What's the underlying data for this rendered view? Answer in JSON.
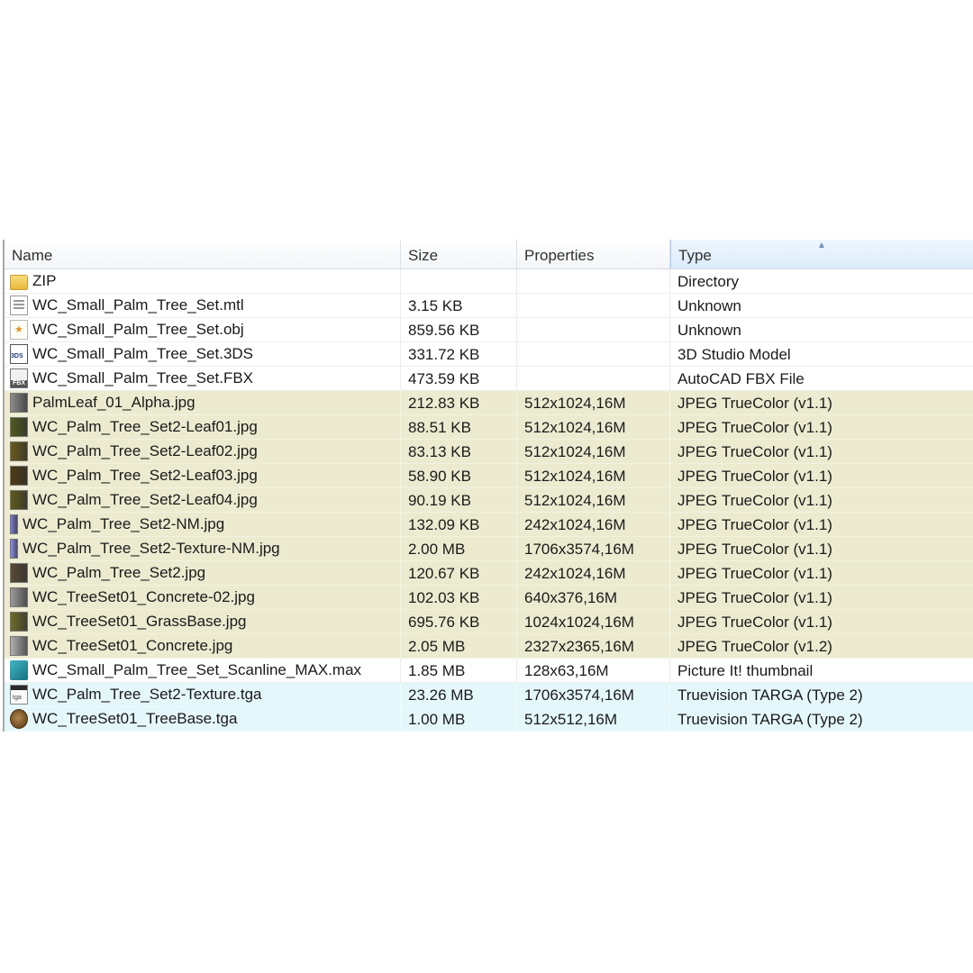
{
  "columns": {
    "name": "Name",
    "size": "Size",
    "properties": "Properties",
    "type": "Type"
  },
  "sort_indicator": "▲",
  "colors": {
    "jpeg_row_highlight": "#ecebd0",
    "tga_row_highlight": "#e4f7fb"
  },
  "rows": [
    {
      "name": "ZIP",
      "size": "",
      "properties": "",
      "type": "Directory",
      "icon": "folder-icon",
      "group": ""
    },
    {
      "name": "WC_Small_Palm_Tree_Set.mtl",
      "size": "3.15 KB",
      "properties": "",
      "type": "Unknown",
      "icon": "document-icon",
      "group": ""
    },
    {
      "name": "WC_Small_Palm_Tree_Set.obj",
      "size": "859.56 KB",
      "properties": "",
      "type": "Unknown",
      "icon": "obj-file-icon",
      "group": ""
    },
    {
      "name": "WC_Small_Palm_Tree_Set.3DS",
      "size": "331.72 KB",
      "properties": "",
      "type": "3D Studio Model",
      "icon": "3ds-file-icon",
      "group": ""
    },
    {
      "name": "WC_Small_Palm_Tree_Set.FBX",
      "size": "473.59 KB",
      "properties": "",
      "type": "AutoCAD FBX File",
      "icon": "fbx-file-icon",
      "group": ""
    },
    {
      "name": "PalmLeaf_01_Alpha.jpg",
      "size": "212.83 KB",
      "properties": "512x1024,16M",
      "type": "JPEG TrueColor (v1.1)",
      "icon": "alpha-thumbnail-icon",
      "group": "jpg",
      "thumb": "#8a8a8a"
    },
    {
      "name": "WC_Palm_Tree_Set2-Leaf01.jpg",
      "size": "88.51 KB",
      "properties": "512x1024,16M",
      "type": "JPEG TrueColor (v1.1)",
      "icon": "leaf-thumbnail-icon",
      "group": "jpg",
      "thumb": "#4f5a1d"
    },
    {
      "name": "WC_Palm_Tree_Set2-Leaf02.jpg",
      "size": "83.13 KB",
      "properties": "512x1024,16M",
      "type": "JPEG TrueColor (v1.1)",
      "icon": "leaf-thumbnail-icon",
      "group": "jpg",
      "thumb": "#6b5a1c"
    },
    {
      "name": "WC_Palm_Tree_Set2-Leaf03.jpg",
      "size": "58.90 KB",
      "properties": "512x1024,16M",
      "type": "JPEG TrueColor (v1.1)",
      "icon": "leaf-thumbnail-icon",
      "group": "jpg",
      "thumb": "#4d3b14"
    },
    {
      "name": "WC_Palm_Tree_Set2-Leaf04.jpg",
      "size": "90.19 KB",
      "properties": "512x1024,16M",
      "type": "JPEG TrueColor (v1.1)",
      "icon": "leaf-thumbnail-icon",
      "group": "jpg",
      "thumb": "#5e5a1a"
    },
    {
      "name": "WC_Palm_Tree_Set2-NM.jpg",
      "size": "132.09 KB",
      "properties": "242x1024,16M",
      "type": "JPEG TrueColor (v1.1)",
      "icon": "normal-map-thumbnail-icon",
      "group": "jpg",
      "thumb": "#7a7ed8"
    },
    {
      "name": "WC_Palm_Tree_Set2-Texture-NM.jpg",
      "size": "2.00 MB",
      "properties": "1706x3574,16M",
      "type": "JPEG TrueColor (v1.1)",
      "icon": "normal-map-thumbnail-icon",
      "group": "jpg",
      "thumb": "#8b8ef0"
    },
    {
      "name": "WC_Palm_Tree_Set2.jpg",
      "size": "120.67 KB",
      "properties": "242x1024,16M",
      "type": "JPEG TrueColor (v1.1)",
      "icon": "bark-thumbnail-icon",
      "group": "jpg",
      "thumb": "#5a4a36"
    },
    {
      "name": "WC_TreeSet01_Concrete-02.jpg",
      "size": "102.03 KB",
      "properties": "640x376,16M",
      "type": "JPEG TrueColor (v1.1)",
      "icon": "concrete-thumbnail-icon",
      "group": "jpg",
      "thumb": "#9a9a9a"
    },
    {
      "name": "WC_TreeSet01_GrassBase.jpg",
      "size": "695.76 KB",
      "properties": "1024x1024,16M",
      "type": "JPEG TrueColor (v1.1)",
      "icon": "grass-thumbnail-icon",
      "group": "jpg",
      "thumb": "#6e6a2a"
    },
    {
      "name": "WC_TreeSet01_Concrete.jpg",
      "size": "2.05 MB",
      "properties": "2327x2365,16M",
      "type": "JPEG TrueColor (v1.2)",
      "icon": "concrete-thumbnail-icon",
      "group": "jpg",
      "thumb": "#b0b0b0"
    },
    {
      "name": "WC_Small_Palm_Tree_Set_Scanline_MAX.max",
      "size": "1.85 MB",
      "properties": "128x63,16M",
      "type": "Picture It! thumbnail",
      "icon": "3ds-max-icon",
      "group": ""
    },
    {
      "name": "WC_Palm_Tree_Set2-Texture.tga",
      "size": "23.26 MB",
      "properties": "1706x3574,16M",
      "type": "Truevision TARGA (Type 2)",
      "icon": "tga-file-icon",
      "group": "tga"
    },
    {
      "name": "WC_TreeSet01_TreeBase.tga",
      "size": "1.00 MB",
      "properties": "512x512,16M",
      "type": "Truevision TARGA (Type 2)",
      "icon": "tree-base-thumbnail-icon",
      "group": "tga"
    }
  ]
}
